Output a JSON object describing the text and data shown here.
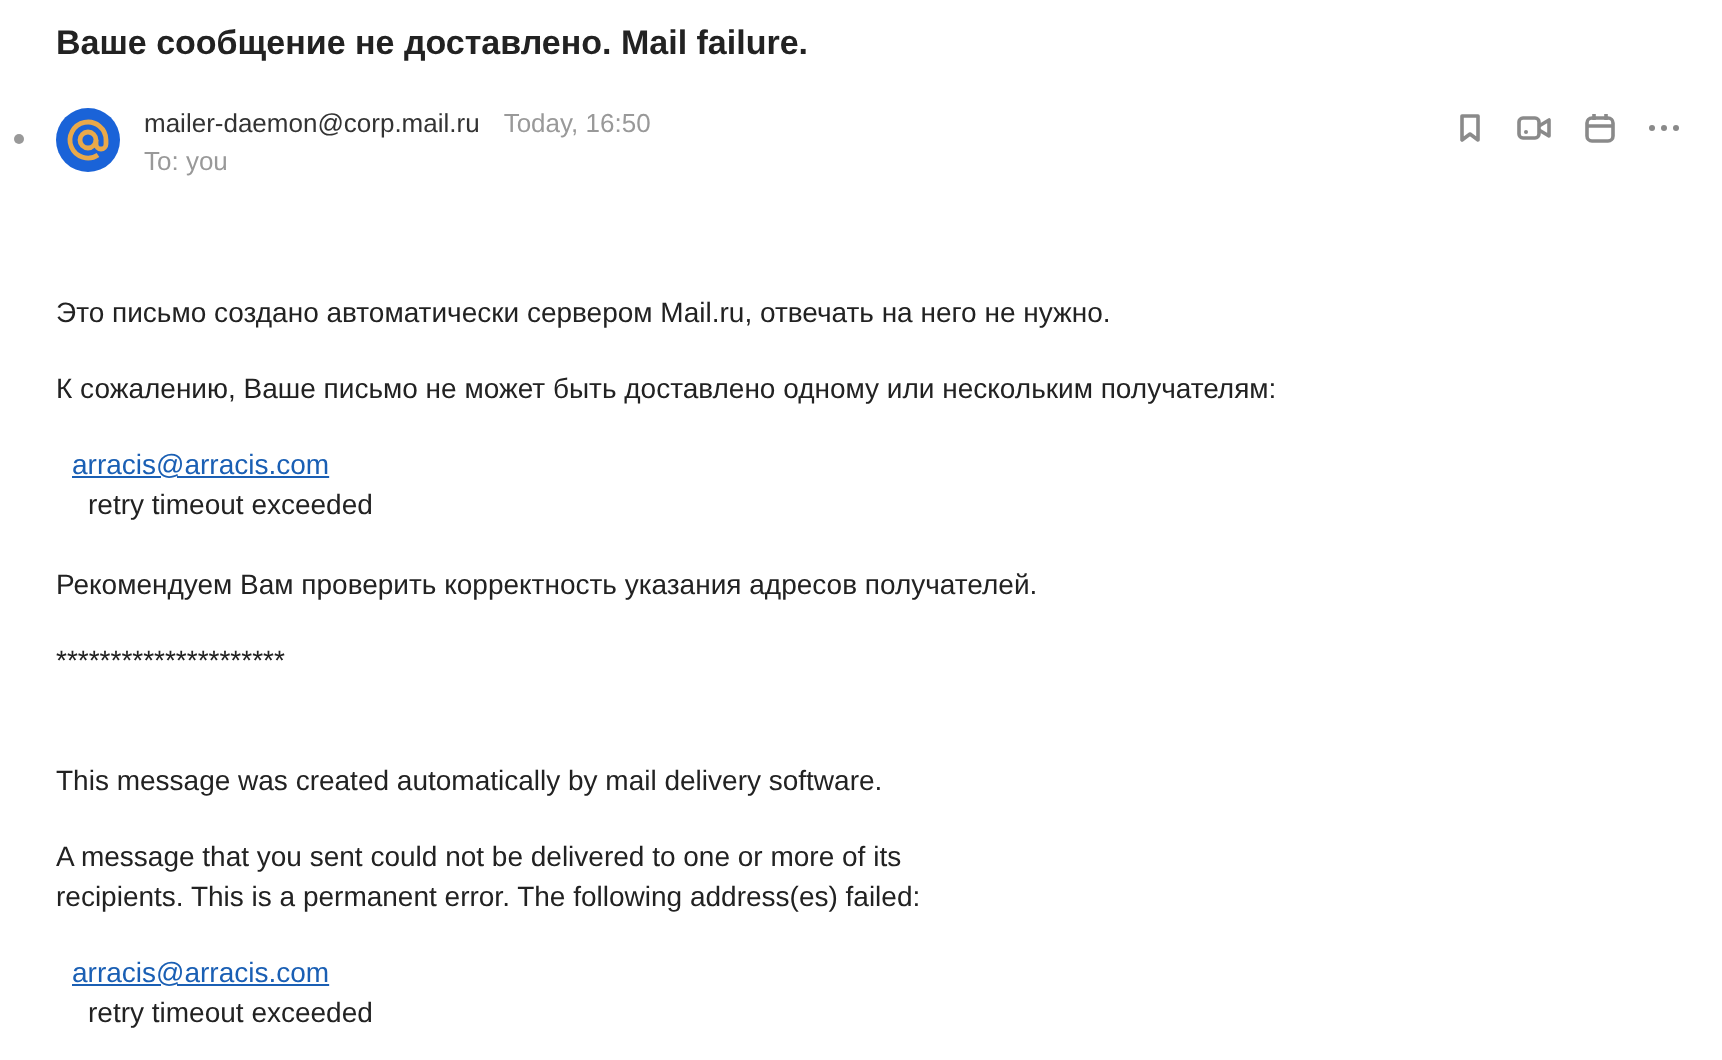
{
  "subject": "Ваше сообщение не доставлено. Mail failure.",
  "message": {
    "unread": true,
    "sender": "mailer-daemon@corp.mail.ru",
    "time": "Today, 16:50",
    "to": "To: you"
  },
  "body": [
    {
      "kind": "text",
      "lines": [
        "Это письмо создано автоматически сервером Mail.ru, отвечать на него не нужно."
      ]
    },
    {
      "kind": "text",
      "lines": [
        "К сожалению, Ваше письмо не может быть доставлено одному или нескольким получателям:"
      ]
    },
    {
      "kind": "recipient",
      "address": "arracis@arracis.com",
      "reason": "retry timeout exceeded"
    },
    {
      "kind": "text",
      "lines": [
        "Рекомендуем Вам проверить корректность указания адресов получателей."
      ]
    },
    {
      "kind": "separator",
      "text": "*********************"
    },
    {
      "kind": "text",
      "lines": [
        "This message was created automatically by mail delivery software."
      ]
    },
    {
      "kind": "text",
      "lines": [
        "A message that you sent could not be delivered to one or more of its",
        "recipients. This is a permanent error. The following address(es) failed:"
      ]
    },
    {
      "kind": "recipient",
      "address": "arracis@arracis.com",
      "reason": "retry timeout exceeded"
    }
  ]
}
